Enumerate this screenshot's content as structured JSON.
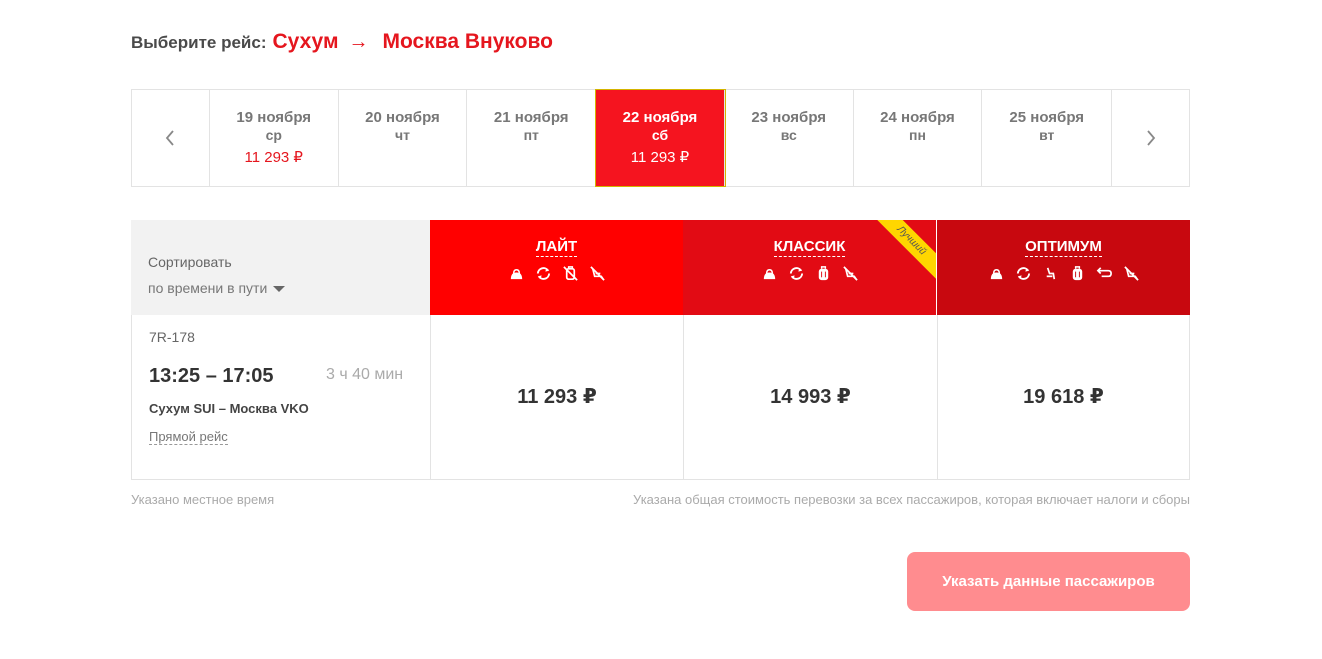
{
  "header": {
    "prefix": "Выберите рейс:",
    "origin": "Сухум",
    "arrow": "→",
    "destination": "Москва Внуково"
  },
  "dates": [
    {
      "label": "19 ноября",
      "weekday": "ср",
      "price": "11 293 ₽",
      "active": false
    },
    {
      "label": "20 ноября",
      "weekday": "чт",
      "price": "",
      "active": false
    },
    {
      "label": "21 ноября",
      "weekday": "пт",
      "price": "",
      "active": false
    },
    {
      "label": "22 ноября",
      "weekday": "сб",
      "price": "11 293 ₽",
      "active": true
    },
    {
      "label": "23 ноября",
      "weekday": "вс",
      "price": "",
      "active": false
    },
    {
      "label": "24 ноября",
      "weekday": "пн",
      "price": "",
      "active": false
    },
    {
      "label": "25 ноября",
      "weekday": "вт",
      "price": "",
      "active": false
    }
  ],
  "sort": {
    "label": "Сортировать",
    "value": "по времени в пути"
  },
  "fares": [
    {
      "name": "ЛАЙТ",
      "icons": [
        "bag-icon",
        "exchange-icon",
        "no-luggage-icon",
        "no-seat-icon"
      ],
      "color": "#ff0000"
    },
    {
      "name": "КЛАССИК",
      "badge": "Лучший",
      "icons": [
        "bag-icon",
        "exchange-icon",
        "luggage-icon",
        "no-seat-icon"
      ],
      "color": "#e20b14"
    },
    {
      "name": "ОПТИМУМ",
      "icons": [
        "bag-icon",
        "exchange-icon",
        "seat-icon",
        "luggage-icon",
        "refund-icon",
        "no-seat-icon"
      ],
      "color": "#c8080f"
    }
  ],
  "flight": {
    "number": "7R-178",
    "times": "13:25 – 17:05",
    "duration": "3 ч 40 мин",
    "route": "Сухум SUI – Москва VKO",
    "type": "Прямой рейс",
    "prices": [
      "11 293 ₽",
      "14 993 ₽",
      "19 618 ₽"
    ]
  },
  "notes": {
    "local_time": "Указано местное время",
    "total_cost": "Указана общая стоимость перевозки за всех пассажиров, которая включает налоги и сборы"
  },
  "cta": {
    "label": "Указать данные пассажиров"
  }
}
